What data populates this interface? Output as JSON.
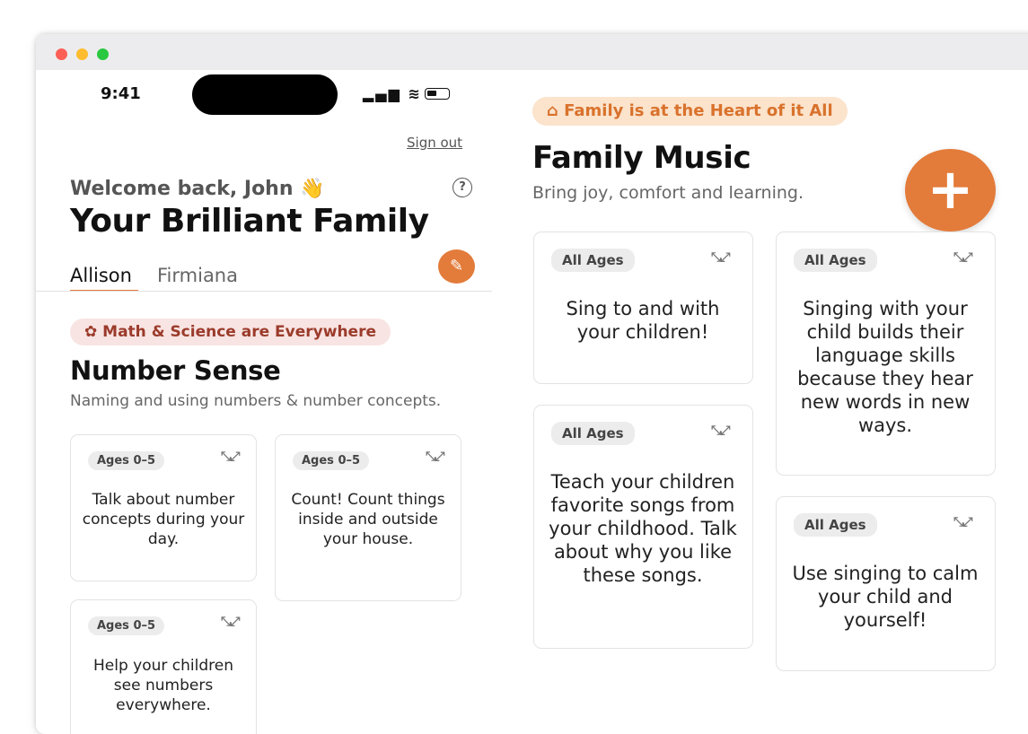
{
  "status_bar": {
    "time": "9:41",
    "signal_wifi": "▂▄▆ ≋"
  },
  "header": {
    "sign_out_label": "Sign out",
    "welcome": "Welcome back, John 👋",
    "help_glyph": "?",
    "title": "Your Brilliant Family",
    "edit_glyph": "✎"
  },
  "tabs": [
    {
      "label": "Allison",
      "active": true
    },
    {
      "label": "Firmiana",
      "active": false
    }
  ],
  "left_section": {
    "pill": "✿ Math & Science are Everywhere",
    "title": "Number Sense",
    "subtitle": "Naming and using numbers & number concepts.",
    "cards": [
      {
        "badge": "Ages 0–5",
        "text": "Talk about number concepts during your day."
      },
      {
        "badge": "Ages 0–5",
        "text": "Count! Count things inside and outside your house."
      },
      {
        "badge": "Ages 0–5",
        "text": "Help your children see numbers everywhere."
      }
    ]
  },
  "right_section": {
    "pill": "⌂ Family is at the Heart of it All",
    "title": "Family Music",
    "subtitle": "Bring joy, comfort and learning.",
    "fab_glyph": "+",
    "cards": [
      {
        "badge": "All Ages",
        "text": "Sing to and with your children!"
      },
      {
        "badge": "All Ages",
        "text": "Singing with your child builds their language skills because they hear new words in new ways."
      },
      {
        "badge": "All Ages",
        "text": "Teach your children favorite songs from your childhood. Talk about why you like these songs."
      },
      {
        "badge": "All Ages",
        "text": "Use singing to calm your child and yourself!"
      }
    ]
  },
  "icons": {
    "expand_glyph": "⤡⤢"
  },
  "colors": {
    "accent_orange": "#e37b3a",
    "math_pill_bg": "#f8e4e2",
    "math_pill_text": "#9b3b2b",
    "family_pill_bg": "#fbe3cc",
    "family_pill_text": "#d9722c"
  }
}
